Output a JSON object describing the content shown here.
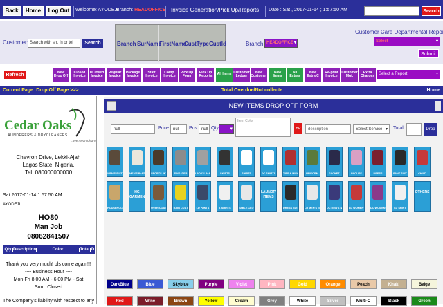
{
  "top": {
    "back": "Back",
    "home": "Home",
    "logout": "Log Out",
    "welcome": "Welcome: AYODEJI",
    "branch_label": "Branch:",
    "branch_value": "HEADOFFICE",
    "title": "Invoice Generation/Pick Up/Reports",
    "date": "Date : Sat , 2017-01-14 ; 1:57:50 AM",
    "search_btn": "Search"
  },
  "customer": {
    "label": "Customer:",
    "search_placeholder": "Search with sn, fn or tel",
    "search_btn": "Search",
    "columns": [
      "Branch",
      "SurName",
      "FirstName",
      "CustType",
      "CustId"
    ],
    "branch_label": "Branch:",
    "branch_value": "HEADOFFICE",
    "care_title": "Customer Care Departmental Reports",
    "care_select": "Select",
    "submit": "Submit"
  },
  "actions": {
    "refresh": "Refresh",
    "buttons": [
      {
        "label": "New Drop Off",
        "color": "#8e22b8"
      },
      {
        "label": "Closed Invoice",
        "color": "#8e22b8"
      },
      {
        "label": "UClosed Invoice",
        "color": "#8e22b8"
      },
      {
        "label": "Regular Invoice",
        "color": "#8e22b8"
      },
      {
        "label": "Package Invoice",
        "color": "#8e22b8"
      },
      {
        "label": "Staff Invoice",
        "color": "#8e22b8"
      },
      {
        "label": "Comp. Invoice",
        "color": "#8e22b8"
      },
      {
        "label": "Pick Up Form",
        "color": "#8e22b8"
      },
      {
        "label": "Pick Up Reports",
        "color": "#8e22b8"
      },
      {
        "label": "All Items",
        "color": "#2aa14a"
      },
      {
        "label": "Customer Ledger",
        "color": "#8e22b8"
      },
      {
        "label": "New Customer",
        "color": "#8e22b8"
      },
      {
        "label": "New Items",
        "color": "#2aa14a"
      },
      {
        "label": "All Extras",
        "color": "#2aa14a"
      },
      {
        "label": "New Extra.C",
        "color": "#8e22b8"
      },
      {
        "label": "Re-print Invoice",
        "color": "#8e22b8"
      },
      {
        "label": "Customer Mgt.",
        "color": "#8e22b8"
      },
      {
        "label": "Extra Charges",
        "color": "#8e22b8"
      }
    ],
    "report_select": "Select a Report"
  },
  "current": {
    "page": "Current Page:  Drop Off Page >>>",
    "overdue": "Total Overdue/Not collecte",
    "home": "Home"
  },
  "receipt": {
    "brand_top": "Cedar Oaks",
    "brand_sub": "LAUNDERERS & DRYCLEANERS",
    "tagline": "...We mean clean!",
    "addr1": "Chevron Drive, Lekki-Ajah",
    "addr2": "Lagos State. Nigeria.",
    "tel": "Tel: 080000000000",
    "datetime": "Sat 2017-01-14 1:57:50 AM",
    "user": "AYODEJI",
    "code": "HO80",
    "name": "Man Job",
    "phone": "08062841507",
    "table_headers": [
      "Qty",
      "Description",
      "Color",
      "Total",
      "D"
    ],
    "thanks": "Thank you very much! pls come again!!!",
    "hours_title": "---- Business Hour ----",
    "hours1": "Mon-Fri 8:00 AM - 6:00 PM - Sat",
    "hours2": "Sun : Closed",
    "liability": "The Company's liability with respect to any"
  },
  "form": {
    "title": "NEW ITEMS DROP OFF FORM",
    "name_value": "null",
    "price_label": "Price:",
    "price_value": "null",
    "pcs_label": "Pcs:",
    "pcs_value": "null",
    "qty_label": "Qty",
    "item_color_placeholder": "Item Color",
    "br_label": "BR",
    "description_placeholder": "description",
    "service_select": "Select Service",
    "total_label": "Total:",
    "drop_btn": "Drop"
  },
  "items_row1": [
    {
      "label": "MEN'S SUIT",
      "color": "#5a4a3a"
    },
    {
      "label": "MEN'S PANTS",
      "color": "#ebe7dc"
    },
    {
      "label": "SPORTS JKT",
      "color": "#4a3a2a"
    },
    {
      "label": "SWEATER",
      "color": "#8c8c8c"
    },
    {
      "label": "LADY'S PANT",
      "color": "#a0a0a0"
    },
    {
      "label": "SKIRTS",
      "color": "#333333"
    },
    {
      "label": "SHIRTS",
      "color": "#ffffff"
    },
    {
      "label": "DC SHIRTS",
      "color": "#ffffff"
    },
    {
      "label": "TIES & MISC",
      "color": "#b03030"
    },
    {
      "label": "UNIFORM",
      "color": "#5b7a3b"
    },
    {
      "label": "JACKET",
      "color": "#2a2a4a"
    },
    {
      "label": "BLOUSE",
      "color": "#d9a0c4"
    },
    {
      "label": "DRESS",
      "color": "#7a1f2f"
    },
    {
      "label": "PANT SUIT",
      "color": "#2a2a2a"
    },
    {
      "label": "CHILD",
      "color": "#c43a3a"
    }
  ],
  "items_row2": [
    {
      "label": "HOUSEHOLD",
      "color": "#c9a66b",
      "type": "img"
    },
    {
      "label": "HG GARMENTS",
      "color": "",
      "type": "text"
    },
    {
      "label": "OVER COAT",
      "color": "#7a5a3a",
      "type": "img"
    },
    {
      "label": "RAIN COAT",
      "color": "#e8d21e",
      "type": "img"
    },
    {
      "label": "LD PANTS",
      "color": "#3a4a6a",
      "type": "img"
    },
    {
      "label": "T-SHIRTS",
      "color": "#f0f0f0",
      "type": "img"
    },
    {
      "label": "TABLE CLOTH",
      "color": "#e8e8e8",
      "type": "img"
    },
    {
      "label": "LAUNDRY ITEMS",
      "color": "",
      "type": "text"
    },
    {
      "label": "DRESS SUIT",
      "color": "#2a2a2a",
      "type": "img"
    },
    {
      "label": "LD MEN'S NATIVE",
      "color": "#e8e8e8",
      "type": "img"
    },
    {
      "label": "DC MEN'S NATIVE",
      "color": "#3a3a7a",
      "type": "img"
    },
    {
      "label": "LD WOMEN'S NATIVE",
      "color": "#c43a3a",
      "type": "img"
    },
    {
      "label": "DC WOMEN'S NATIVE",
      "color": "#8a3a8a",
      "type": "img"
    },
    {
      "label": "LD SHIRT",
      "color": "#f0f0f0",
      "type": "img"
    },
    {
      "label": "OTHERS",
      "color": "",
      "type": "text"
    }
  ],
  "colors_row1": [
    {
      "label": "DarkBlue",
      "bg": "#00008b",
      "fg": "#ffffff"
    },
    {
      "label": "Blue",
      "bg": "#3a5ad4",
      "fg": "#ffffff"
    },
    {
      "label": "Skyblue",
      "bg": "#87ceeb",
      "fg": "#000000"
    },
    {
      "label": "Purple",
      "bg": "#800080",
      "fg": "#ffffff"
    },
    {
      "label": "Violet",
      "bg": "#ee82ee",
      "fg": "#ffffff"
    },
    {
      "label": "Pink",
      "bg": "#ffb6c1",
      "fg": "#ffffff"
    },
    {
      "label": "Gold",
      "bg": "#ffd700",
      "fg": "#ffffff"
    },
    {
      "label": "Orange",
      "bg": "#ff8c00",
      "fg": "#ffffff"
    },
    {
      "label": "Peach",
      "bg": "#e9c9a8",
      "fg": "#000000"
    },
    {
      "label": "Khaki",
      "bg": "#c3b091",
      "fg": "#ffffff"
    },
    {
      "label": "Beige",
      "bg": "#f5f5dc",
      "fg": "#000000"
    }
  ],
  "colors_row2": [
    {
      "label": "Red",
      "bg": "#e01818",
      "fg": "#ffffff"
    },
    {
      "label": "Wine",
      "bg": "#7b1d2a",
      "fg": "#ffffff"
    },
    {
      "label": "Brown",
      "bg": "#8b4513",
      "fg": "#ffffff"
    },
    {
      "label": "Yellow",
      "bg": "#ffff00",
      "fg": "#000000"
    },
    {
      "label": "Cream",
      "bg": "#fffdd0",
      "fg": "#000000"
    },
    {
      "label": "Grey",
      "bg": "#808080",
      "fg": "#ffffff"
    },
    {
      "label": "White",
      "bg": "#ffffff",
      "fg": "#000000"
    },
    {
      "label": "Silver",
      "bg": "#c0c0c0",
      "fg": "#ffffff"
    },
    {
      "label": "Multi-C",
      "bg": "#ffffff",
      "fg": "#000000"
    },
    {
      "label": "Black",
      "bg": "#000000",
      "fg": "#ffffff"
    },
    {
      "label": "Green",
      "bg": "#1a8a1a",
      "fg": "#ffffff"
    }
  ]
}
